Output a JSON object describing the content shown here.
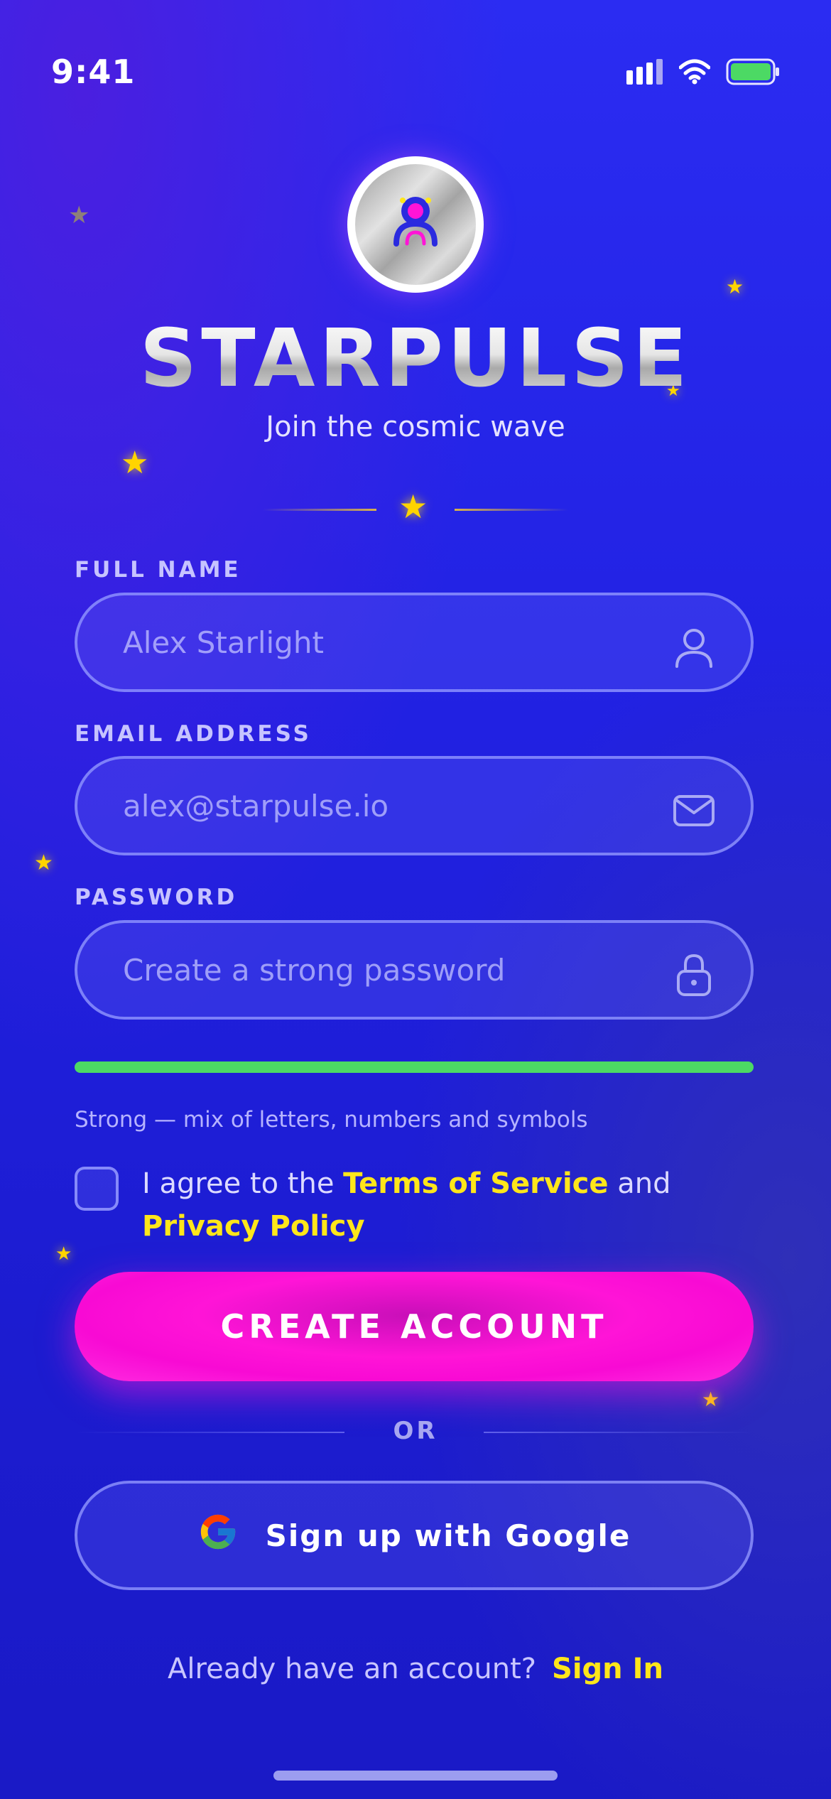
{
  "status_bar": {
    "time": "9:41",
    "icons": [
      "signal-icon",
      "wifi-icon",
      "battery-icon"
    ]
  },
  "brand": {
    "name": "STARPULSE",
    "tagline": "Join the cosmic wave",
    "logo_icon": "astronaut-icon"
  },
  "form": {
    "full_name": {
      "label": "FULL NAME",
      "placeholder": "Alex Starlight",
      "icon": "user-icon"
    },
    "email": {
      "label": "EMAIL ADDRESS",
      "placeholder": "alex@starpulse.io",
      "icon": "mail-icon"
    },
    "password": {
      "label": "PASSWORD",
      "placeholder": "Create a strong password",
      "icon": "lock-icon"
    },
    "strength": {
      "level": 1.0,
      "color": "#4cd964",
      "text": "Strong — mix of letters, numbers and symbols"
    },
    "agree": {
      "checked": false,
      "prefix": "I agree to the ",
      "terms": "Terms of Service",
      "middle": " and ",
      "privacy": "Privacy Policy"
    }
  },
  "actions": {
    "create_account": "CREATE ACCOUNT",
    "or": "OR",
    "google": "Sign up with Google",
    "have_account": "Already have an account?",
    "sign_in": "Sign In"
  },
  "colors": {
    "background": "#2121e2",
    "accent_pink": "#ff14d7",
    "accent_yellow": "#ffe61a",
    "success_green": "#4cd964"
  }
}
